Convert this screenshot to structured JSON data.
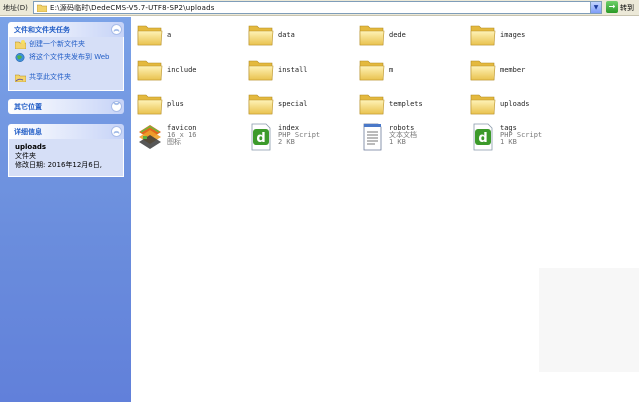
{
  "address_bar": {
    "label": "地址(D)",
    "path": "E:\\源码临时\\DedeCMS-V5.7-UTF8-SP2\\uploads",
    "go_label": "转到"
  },
  "sidebar": {
    "file_tasks": {
      "title": "文件和文件夹任务",
      "items": [
        {
          "label": "创建一个新文件夹",
          "icon": "new-folder-icon"
        },
        {
          "label": "将这个文件夹发布到 Web",
          "icon": "publish-web-icon"
        },
        {
          "label": "共享此文件夹",
          "icon": "share-folder-icon"
        }
      ]
    },
    "other_places": {
      "title": "其它位置"
    },
    "details": {
      "title": "详细信息",
      "name": "uploads",
      "type": "文件夹",
      "modified": "修改日期: 2016年12月6日,"
    }
  },
  "items": [
    {
      "name": "a",
      "kind": "folder"
    },
    {
      "name": "data",
      "kind": "folder"
    },
    {
      "name": "dede",
      "kind": "folder"
    },
    {
      "name": "images",
      "kind": "folder"
    },
    {
      "name": "include",
      "kind": "folder"
    },
    {
      "name": "install",
      "kind": "folder"
    },
    {
      "name": "m",
      "kind": "folder"
    },
    {
      "name": "member",
      "kind": "folder"
    },
    {
      "name": "plus",
      "kind": "folder"
    },
    {
      "name": "special",
      "kind": "folder"
    },
    {
      "name": "templets",
      "kind": "folder"
    },
    {
      "name": "uploads",
      "kind": "folder"
    },
    {
      "name": "favicon",
      "kind": "ico",
      "line2": "16 x 16",
      "line3": "图标"
    },
    {
      "name": "index",
      "kind": "php",
      "line2": "PHP Script",
      "line3": "2 KB"
    },
    {
      "name": "robots",
      "kind": "txt",
      "line2": "文本文档",
      "line3": "1 KB"
    },
    {
      "name": "tags",
      "kind": "php",
      "line2": "PHP Script",
      "line3": "1 KB"
    }
  ]
}
